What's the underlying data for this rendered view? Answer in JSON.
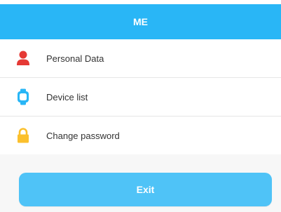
{
  "header": {
    "title": "ME",
    "background": "#29b6f6"
  },
  "menu": {
    "items": [
      {
        "label": "Personal Data",
        "icon": "person-icon",
        "icon_color": "#e53935"
      },
      {
        "label": "Device list",
        "icon": "watch-icon",
        "icon_color": "#29b6f6"
      },
      {
        "label": "Change password",
        "icon": "lock-icon",
        "icon_color": "#fbc02d"
      }
    ]
  },
  "exit": {
    "label": "Exit",
    "background": "#4fc3f7"
  }
}
